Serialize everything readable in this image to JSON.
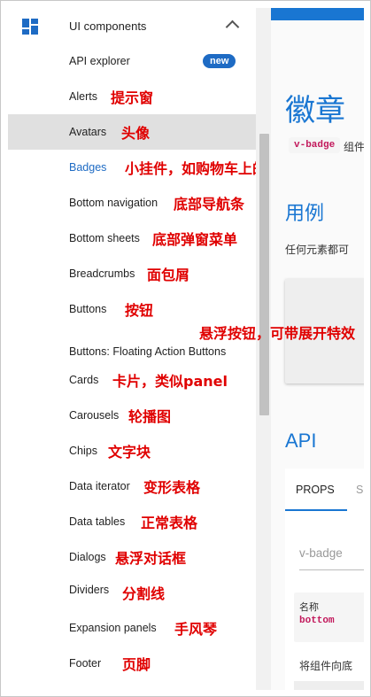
{
  "sidebar": {
    "group_title": "UI components",
    "items": [
      {
        "label": "API explorer",
        "badge": "new",
        "note": ""
      },
      {
        "label": "Alerts",
        "note": "提示窗"
      },
      {
        "label": "Avatars",
        "note": "头像",
        "active": true
      },
      {
        "label": "Badges",
        "note": "小挂件，如购物车上的数字"
      },
      {
        "label": "Bottom navigation",
        "note": "底部导航条"
      },
      {
        "label": "Bottom sheets",
        "note": "底部弹窗菜单"
      },
      {
        "label": "Breadcrumbs",
        "note": "面包屑"
      },
      {
        "label": "Buttons",
        "note": "按钮"
      },
      {
        "label": "Buttons: Floating Action Buttons",
        "note": ""
      },
      {
        "label": "Cards",
        "note": "卡片，类似panel"
      },
      {
        "label": "Carousels",
        "note": "轮播图"
      },
      {
        "label": "Chips",
        "note": "文字块"
      },
      {
        "label": "Data iterator",
        "note": "变形表格"
      },
      {
        "label": "Data tables",
        "note": "正常表格"
      },
      {
        "label": "Dialogs",
        "note": "悬浮对话框"
      },
      {
        "label": "Dividers",
        "note": "分割线"
      },
      {
        "label": "Expansion panels",
        "note": "手风琴"
      },
      {
        "label": "Footer",
        "note": "页脚"
      }
    ],
    "floating_note": "悬浮按钮，可带展开特效"
  },
  "main": {
    "title": "徽章",
    "tag": "v-badge",
    "tag_desc": "组件",
    "usage_heading": "用例",
    "usage_text": "任何元素都可",
    "api_heading": "API",
    "tabs": [
      "PROPS",
      "S"
    ],
    "select_value": "v-badge",
    "row_key": "名称",
    "row_value": "bottom",
    "row_desc": "将组件向底"
  },
  "colors": {
    "accent": "#1976d2",
    "note": "#e00000"
  }
}
